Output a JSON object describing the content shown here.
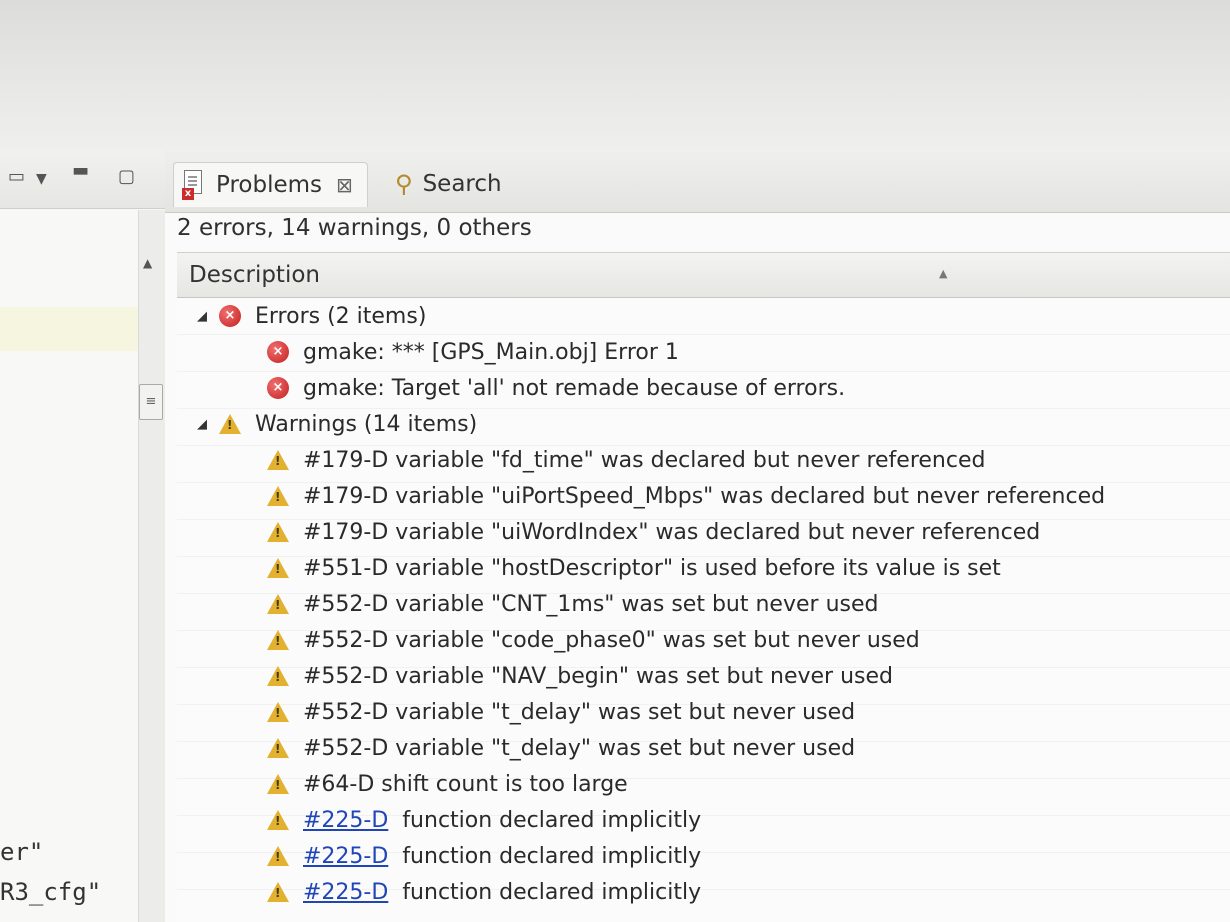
{
  "left_panel": {
    "text_lines": [
      "er\"",
      "R3_cfg\""
    ]
  },
  "problems_view": {
    "tabs": [
      {
        "label": "Problems",
        "active": true,
        "icon": "problems-icon"
      },
      {
        "label": "Search",
        "active": false,
        "icon": "search-icon"
      }
    ],
    "summary": "2 errors, 14 warnings, 0 others",
    "column_header": "Description",
    "groups": [
      {
        "label": "Errors (2 items)",
        "severity": "error",
        "items": [
          {
            "code": "",
            "text": "gmake: *** [GPS_Main.obj] Error 1",
            "link": false
          },
          {
            "code": "",
            "text": "gmake: Target 'all' not remade because of errors.",
            "link": false
          }
        ]
      },
      {
        "label": "Warnings (14 items)",
        "severity": "warning",
        "items": [
          {
            "code": "",
            "text": "#179-D variable \"fd_time\" was declared but never referenced",
            "link": false
          },
          {
            "code": "",
            "text": "#179-D variable \"uiPortSpeed_Mbps\" was declared but never referenced",
            "link": false
          },
          {
            "code": "",
            "text": "#179-D variable \"uiWordIndex\" was declared but never referenced",
            "link": false
          },
          {
            "code": "",
            "text": "#551-D variable \"hostDescriptor\" is used before its value is set",
            "link": false
          },
          {
            "code": "",
            "text": "#552-D variable \"CNT_1ms\" was set but never used",
            "link": false
          },
          {
            "code": "",
            "text": "#552-D variable \"code_phase0\" was set but never used",
            "link": false
          },
          {
            "code": "",
            "text": "#552-D variable \"NAV_begin\" was set but never used",
            "link": false
          },
          {
            "code": "",
            "text": "#552-D variable \"t_delay\" was set but never used",
            "link": false
          },
          {
            "code": "",
            "text": "#552-D variable \"t_delay\" was set but never used",
            "link": false
          },
          {
            "code": "",
            "text": "#64-D shift count is too large",
            "link": false
          },
          {
            "code": "#225-D",
            "text": "function declared implicitly",
            "link": true
          },
          {
            "code": "#225-D",
            "text": "function declared implicitly",
            "link": true
          },
          {
            "code": "#225-D",
            "text": "function declared implicitly",
            "link": true
          }
        ]
      }
    ]
  },
  "colors": {
    "error": "#c41e1e",
    "warning": "#e2b12f",
    "link": "#1f45b8"
  }
}
